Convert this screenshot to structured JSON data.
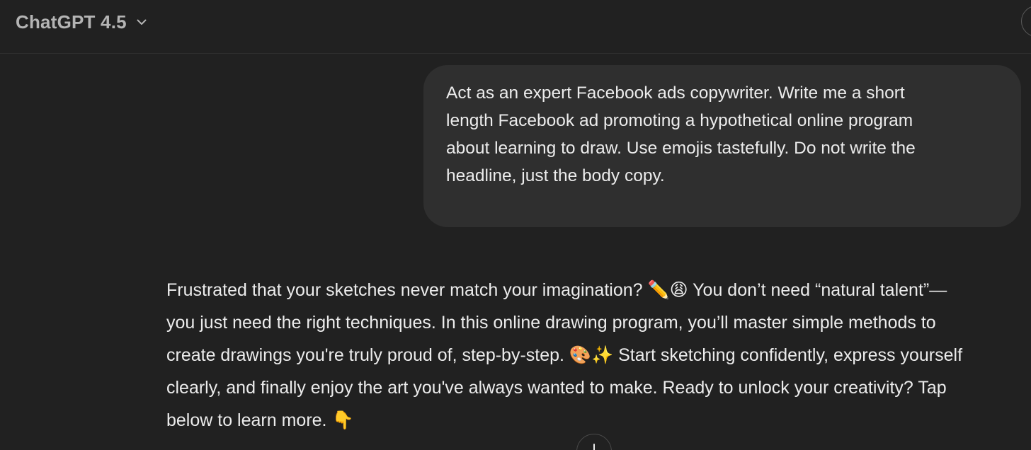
{
  "header": {
    "model_name": "ChatGPT 4.5",
    "dropdown_icon": "chevron-down-icon"
  },
  "conversation": {
    "user_message": "Act as an expert Facebook ads copywriter. Write me a short\nlength Facebook ad promoting a hypothetical online program\nabout learning to draw. Use emojis tastefully. Do not write the\nheadline, just the body copy.",
    "assistant_message": "Frustrated that your sketches never match your imagination? ✏️😩 You don’t need “natural talent”—\nyou just need the right techniques. In this online drawing program, you’ll master simple methods to\ncreate drawings you're truly proud of, step-by-step. 🎨✨ Start sketching confidently, express yourself\nclearly, and finally enjoy the art you've always wanted to make. Ready to unlock your creativity? Tap\nbelow to learn more. 👇"
  },
  "scroll_button": {
    "icon": "arrow-down-icon"
  },
  "colors": {
    "background": "#212121",
    "user_bubble": "#2f2f2f",
    "text": "#ececec",
    "header_text": "#b4b4b4"
  }
}
